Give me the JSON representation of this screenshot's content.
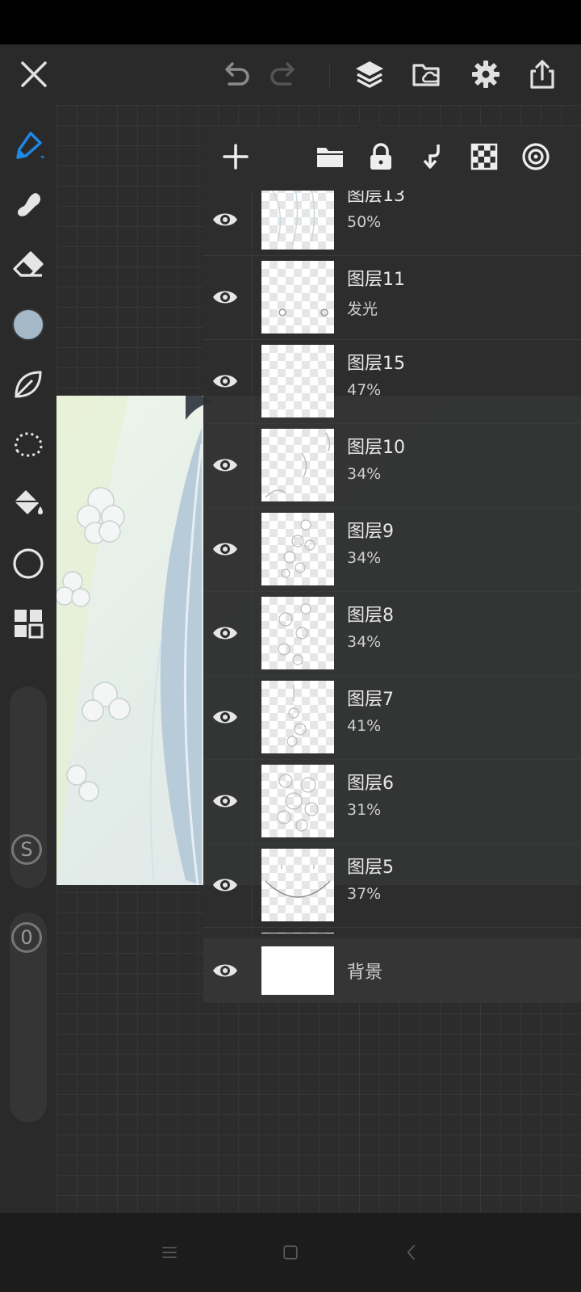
{
  "colors": {
    "accent_blue": "#1e88e5",
    "current_color": "#a4b8c8",
    "panel_bg": "#2d2d2d",
    "toolbar_bg": "#2a2a2a"
  },
  "top_bar": {
    "icons": [
      "close-icon",
      "undo-icon",
      "redo-icon",
      "layers-icon",
      "cloud-folder-icon",
      "gear-icon",
      "share-icon"
    ]
  },
  "left_toolbar": {
    "tools": [
      "brush-tool-icon",
      "smudge-tool-icon",
      "eraser-tool-icon",
      "color-swatch",
      "leaf-tool-icon",
      "lasso-select-icon",
      "fill-bucket-icon",
      "shape-circle-icon",
      "grid-tool-icon"
    ],
    "size_label": "S",
    "opacity_label": "0"
  },
  "layers_panel": {
    "toolbar_icons": [
      "add-layer-icon",
      "folder-icon",
      "lock-icon",
      "merge-down-icon",
      "checker-icon",
      "target-icon"
    ],
    "layers": [
      {
        "name": "图层13",
        "detail": "50%"
      },
      {
        "name": "图层11",
        "detail": "发光"
      },
      {
        "name": "图层15",
        "detail": "47%"
      },
      {
        "name": "图层10",
        "detail": "34%"
      },
      {
        "name": "图层9",
        "detail": "34%"
      },
      {
        "name": "图层8",
        "detail": "34%"
      },
      {
        "name": "图层7",
        "detail": "41%"
      },
      {
        "name": "图层6",
        "detail": "31%"
      },
      {
        "name": "图层5",
        "detail": "37%"
      }
    ],
    "background_layer": {
      "name": "背景"
    }
  },
  "nav_bar": {
    "icons": [
      "menu-icon",
      "home-square-icon",
      "back-chevron-icon"
    ]
  }
}
